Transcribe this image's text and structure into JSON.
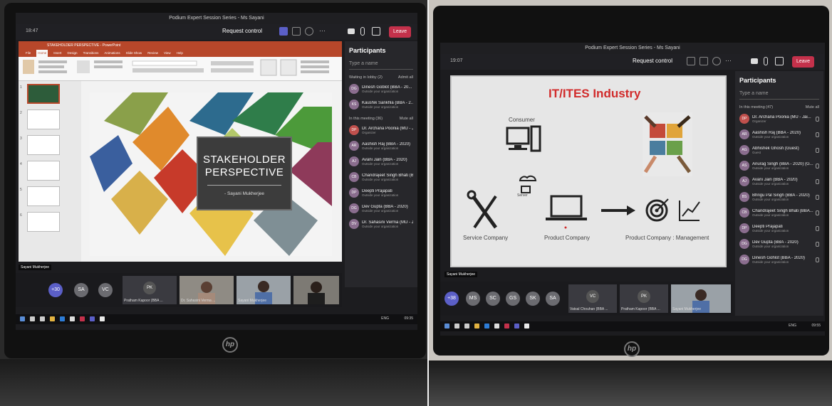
{
  "left": {
    "window_title": "Podium Expert Session Series - Ms Sayani",
    "timer": "18:47",
    "request_control": "Request control",
    "leave": "Leave",
    "slide": {
      "title_line1": "STAKEHOLDER",
      "title_line2": "PERSPECTIVE",
      "subtitle": "- Sayani Mukherjee"
    },
    "presenter_label": "Sayani Mukherjee",
    "participants": {
      "header": "Participants",
      "search_placeholder": "Type a name",
      "lobby_header": "Waiting in lobby (2)",
      "lobby_action": "Admit all",
      "lobby": [
        {
          "initials": "DG",
          "name": "Dinesh Goblot (BBA - 20...",
          "sub": "Outside your organization"
        },
        {
          "initials": "KS",
          "name": "Kaushik Sankhla (BBA - 2...",
          "sub": "Outside your organization"
        }
      ],
      "meeting_header": "In this meeting (36)",
      "meeting_action": "Mute all",
      "meeting": [
        {
          "initials": "DP",
          "name": "Dr. Archana Poonia (MU - Jai...",
          "sub": "Organizer"
        },
        {
          "initials": "AR",
          "name": "Aashish Raj (BBA - 2020)",
          "sub": "Outside your organization"
        },
        {
          "initials": "AJ",
          "name": "Avani Jain (BBA - 2020)",
          "sub": "Outside your organization"
        },
        {
          "initials": "CB",
          "name": "Chandrajeet Singh Bhati (BBA...",
          "sub": "Outside your organization"
        },
        {
          "initials": "DP",
          "name": "Deepti Prajapati",
          "sub": "Outside your organization"
        },
        {
          "initials": "DG",
          "name": "Dev Gupta (BBA - 2020)",
          "sub": "Outside your organization"
        },
        {
          "initials": "DV",
          "name": "Dr. Sahasini Verma (MU - Jaip...",
          "sub": "Outside your organization"
        }
      ]
    },
    "tiles": {
      "more": "+30",
      "circles": [
        "SA",
        "VC"
      ],
      "pk_initials": "PK",
      "pk_label": "Pratham Kapoor (BBA ...",
      "video2_label": "Dr. Sahasini Verma ...",
      "video3_label": "Sayani Mukherjee"
    },
    "taskbar": {
      "lang": "ENG",
      "time": "09:35"
    },
    "ppt": {
      "title": "STAKEHOLDER PERSPECTIVE - PowerPoint",
      "tabs": [
        "File",
        "Home",
        "Insert",
        "Design",
        "Transitions",
        "Animations",
        "Slide Show",
        "Review",
        "View",
        "Help"
      ],
      "slide_numbers": [
        "1",
        "2",
        "3",
        "4",
        "5",
        "6"
      ]
    },
    "brand": "hp"
  },
  "right": {
    "window_title": "Podium Expert Session Series - Ms Sayani",
    "timer": "19:07",
    "request_control": "Request control",
    "leave": "Leave",
    "slide": {
      "title": "IT/ITES Industry",
      "consumer": "Consumer",
      "server": "Server",
      "service_company": "Service Company",
      "product_company": "Product Company",
      "management": "Product Company : Management"
    },
    "presenter_label": "Sayani Mukherjee",
    "participants": {
      "header": "Participants",
      "search_placeholder": "Type a name",
      "meeting_header": "In this meeting (47)",
      "meeting_action": "Mute all",
      "meeting": [
        {
          "initials": "DP",
          "name": "Dr. Archana Poonia (MU - Jai...",
          "sub": "Organizer"
        },
        {
          "initials": "AR",
          "name": "Aashish Raj (BBA - 2020)",
          "sub": "Outside your organization"
        },
        {
          "initials": "AG",
          "name": "Abhishek Ghosh (Guest)",
          "sub": "Guest"
        },
        {
          "initials": "AS",
          "name": "Anurag Singh (BBA - 2020) (G...",
          "sub": "Outside your organization"
        },
        {
          "initials": "AJ",
          "name": "Avani Jain (BBA - 2020)",
          "sub": "Outside your organization"
        },
        {
          "initials": "BS",
          "name": "Bhrigu Pal Singh (BBA - 2020)",
          "sub": "Outside your organization"
        },
        {
          "initials": "CB",
          "name": "Chandrajeet Singh Bhati (BBA...",
          "sub": "Outside your organization"
        },
        {
          "initials": "DP",
          "name": "Deepti Prajapati",
          "sub": "Outside your organization"
        },
        {
          "initials": "DG",
          "name": "Dev Gupta (BBA - 2020)",
          "sub": "Outside your organization"
        },
        {
          "initials": "DG",
          "name": "Dinesh Gohlot (BBA - 2020)",
          "sub": "Outside your organization"
        }
      ]
    },
    "tiles": {
      "more": "+38",
      "circles": [
        "MS",
        "SC",
        "GS",
        "SK",
        "SA"
      ],
      "vc_initials": "VC",
      "vc_label": "Vatsal Chouhan (BBA ...",
      "pk_initials": "PK",
      "pk_label": "Pratham Kapoor (BBA ...",
      "video_label": "Sayani Mukherjee"
    },
    "taskbar": {
      "lang": "ENG",
      "time": "09:55"
    },
    "brand": "hp"
  }
}
